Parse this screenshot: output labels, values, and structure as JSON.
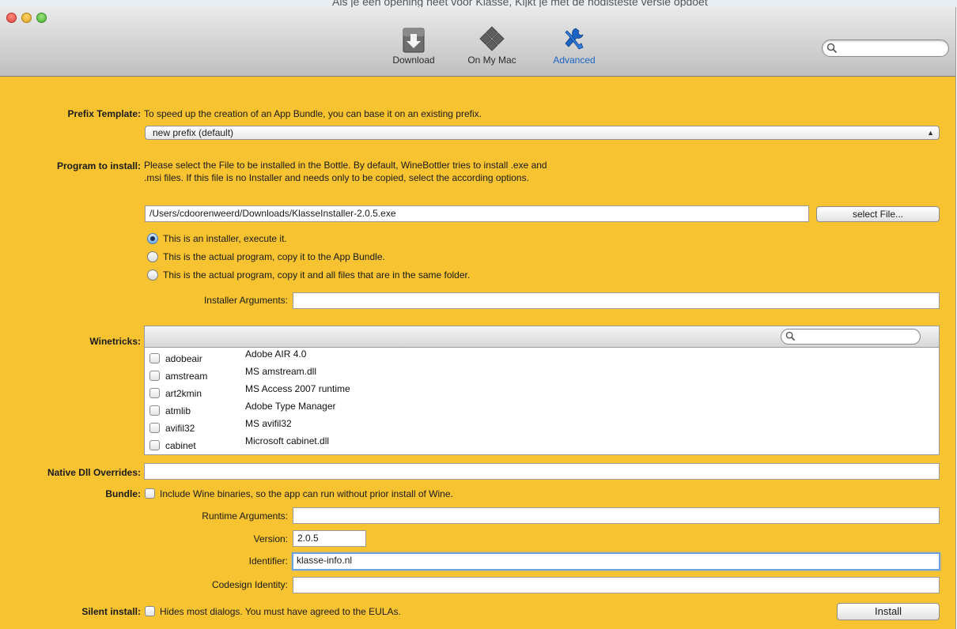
{
  "background": {
    "text": "Als je een opening heet voor Klasse, Kijkt je met de nodisteste versie opdoet"
  },
  "window": {
    "toolbar": {
      "tabs": [
        {
          "label": "Download",
          "icon": "download-icon"
        },
        {
          "label": "On My Mac",
          "icon": "on-my-mac-icon"
        },
        {
          "label": "Advanced",
          "icon": "advanced-tools-icon",
          "active": true
        }
      ],
      "search_placeholder": ""
    }
  },
  "prefix": {
    "label": "Prefix Template:",
    "description": "To speed up the creation of an App Bundle, you can base it on an existing prefix.",
    "selected": "new prefix (default)"
  },
  "program": {
    "label": "Program to install:",
    "description": "Please select the File to be installed in the Bottle. By default, WineBottler tries to install .exe and .msi files. If this file is no Installer and needs only to be copied, select the according options.",
    "path": "/Users/cdoorenweerd/Downloads/KlasseInstaller-2.0.5.exe",
    "select_button": "select File...",
    "options": [
      "This is an installer, execute it.",
      "This is the actual program, copy it to the App Bundle.",
      "This is the actual program, copy it and all files that are in the same folder."
    ],
    "selected_option": 0,
    "installer_args_label": "Installer Arguments:",
    "installer_args_value": ""
  },
  "winetricks": {
    "label": "Winetricks:",
    "search_value": "",
    "items": [
      {
        "name": "adobeair",
        "desc": "Adobe AIR 4.0"
      },
      {
        "name": "amstream",
        "desc": "MS amstream.dll"
      },
      {
        "name": "art2kmin",
        "desc": "MS Access 2007 runtime"
      },
      {
        "name": "atmlib",
        "desc": "Adobe Type Manager"
      },
      {
        "name": "avifil32",
        "desc": "MS avifil32"
      },
      {
        "name": "cabinet",
        "desc": "Microsoft cabinet.dll"
      }
    ]
  },
  "native_dll": {
    "label": "Native Dll Overrides:",
    "value": ""
  },
  "bundle": {
    "label": "Bundle:",
    "checkbox_label": "Include Wine binaries, so the app can run without prior install of Wine.",
    "checked": false,
    "runtime_args_label": "Runtime Arguments:",
    "runtime_args_value": "",
    "version_label": "Version:",
    "version_value": "2.0.5",
    "identifier_label": "Identifier:",
    "identifier_value": "klasse-info.nl",
    "codesign_label": "Codesign Identity:",
    "codesign_value": ""
  },
  "silent": {
    "label": "Silent install:",
    "checkbox_label": "Hides most dialogs. You must have agreed to the EULAs.",
    "checked": false
  },
  "install_button": "Install",
  "colors": {
    "panel": "#f7c331",
    "active_tab": "#1b64c4",
    "focus_ring": "#6ba2db"
  }
}
